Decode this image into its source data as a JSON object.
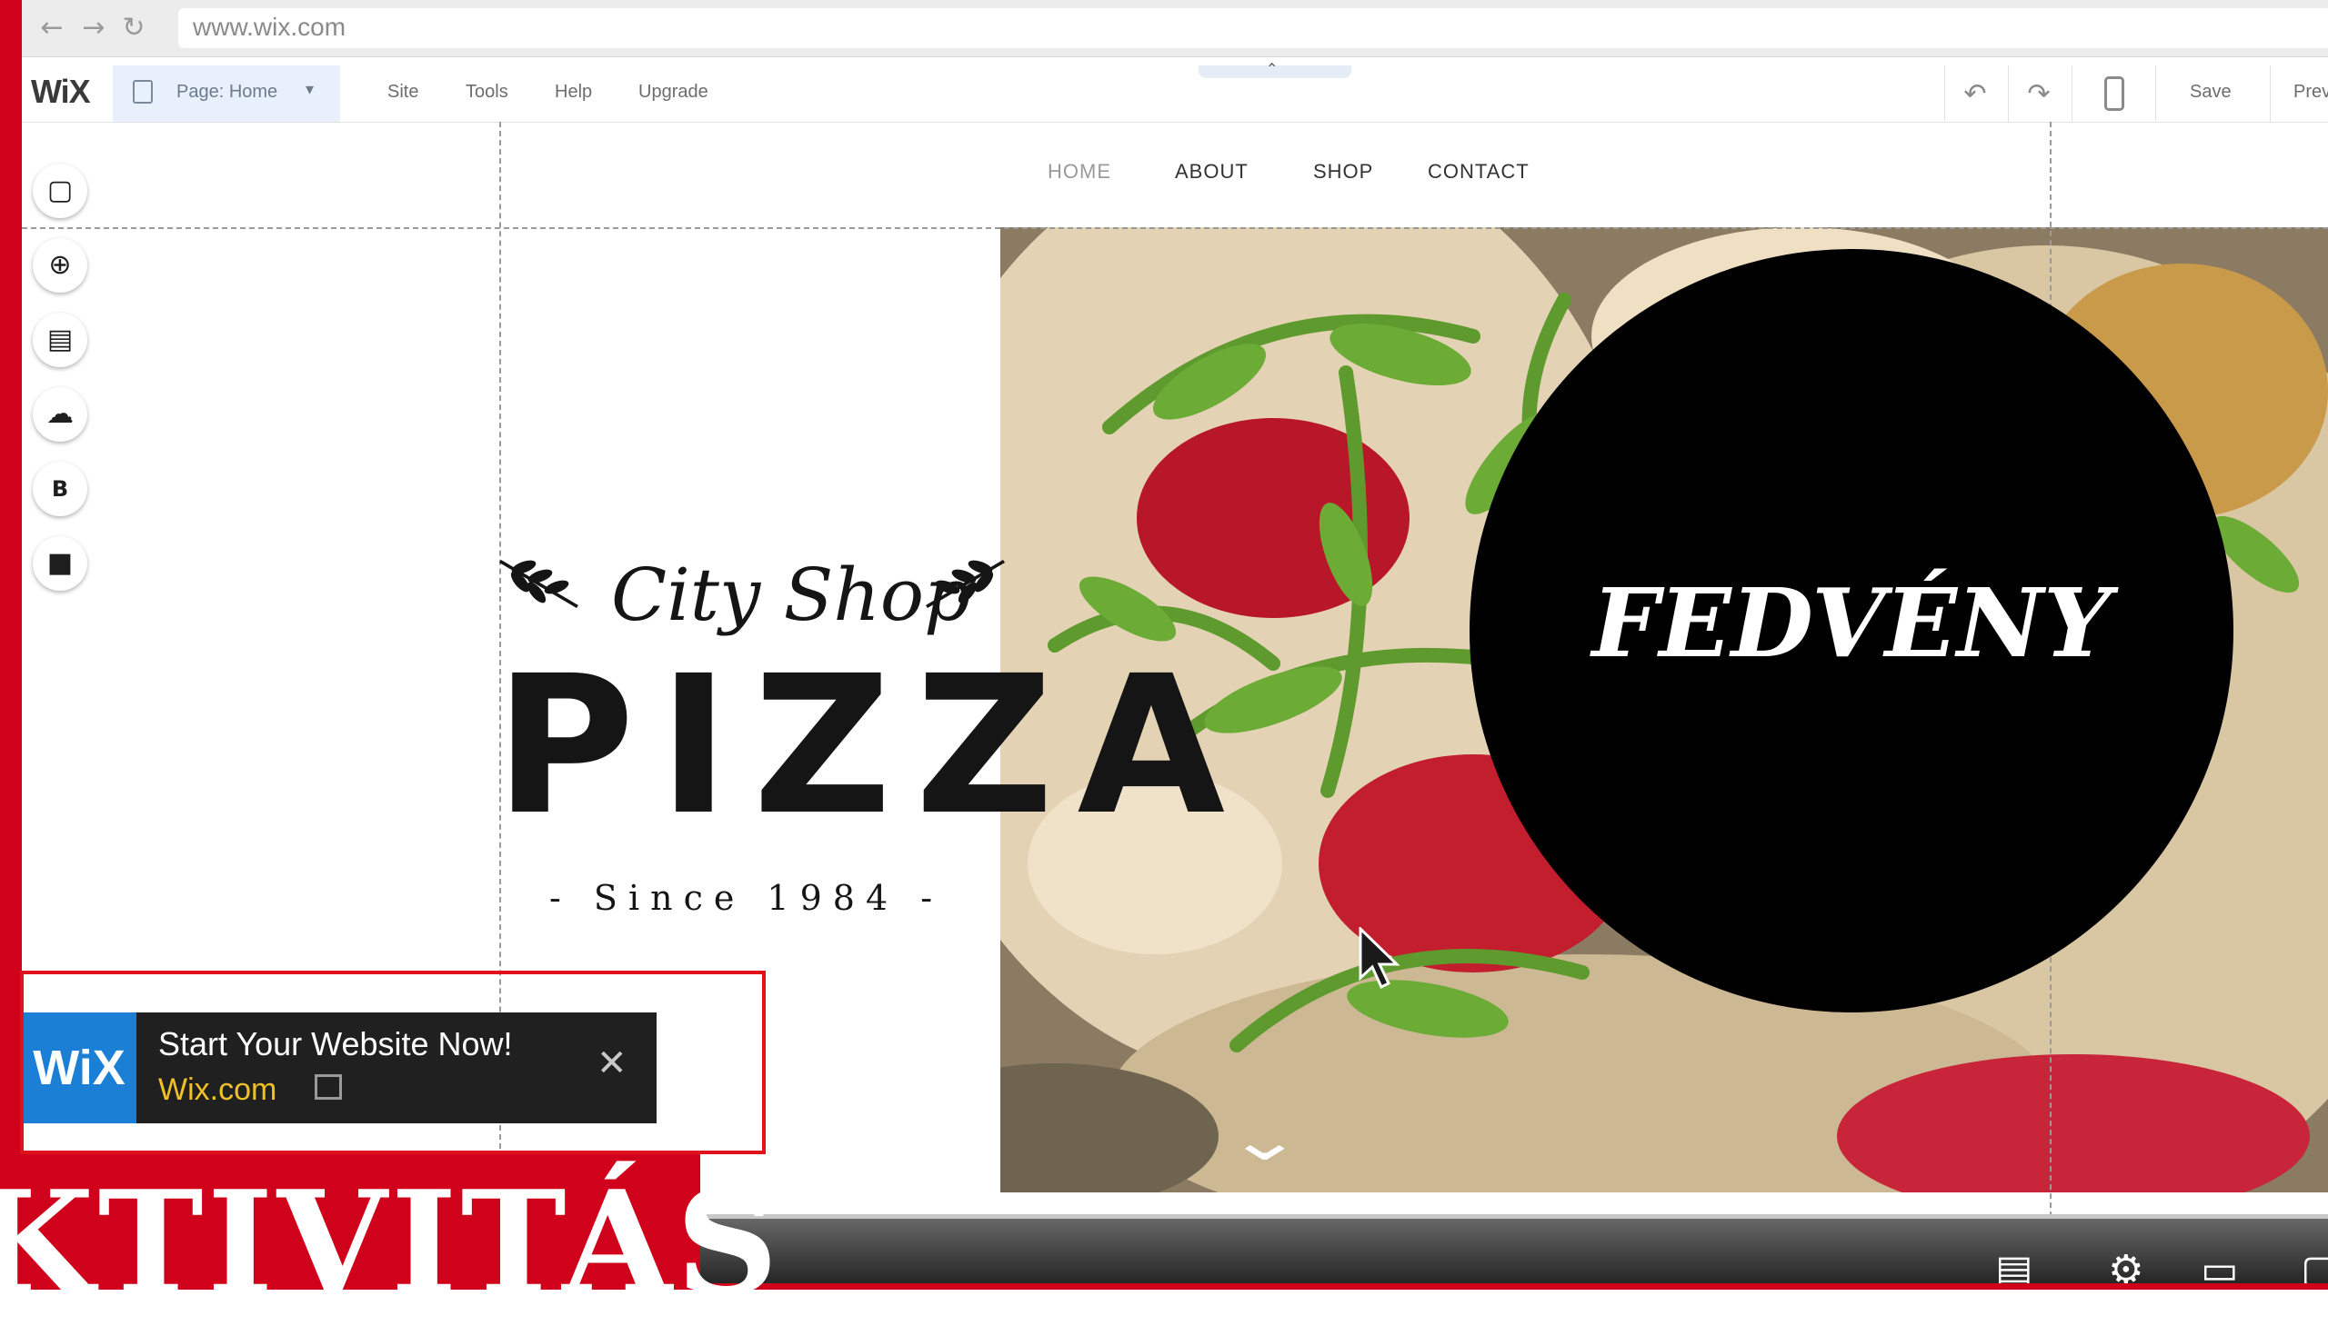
{
  "browser": {
    "url": "www.wix.com",
    "back_icon": "arrow-left-icon",
    "forward_icon": "arrow-right-icon",
    "reload_icon": "reload-icon"
  },
  "editor": {
    "logo": "WiX",
    "page_label": "Page: Home",
    "menu": [
      "Site",
      "Tools",
      "Help",
      "Upgrade"
    ],
    "save_label": "Save",
    "preview_label": "Prev"
  },
  "tools": [
    "background-icon",
    "add-icon",
    "app-market-icon",
    "upload-icon",
    "blog-icon",
    "store-icon"
  ],
  "site": {
    "nav": [
      "HOME",
      "ABOUT",
      "SHOP",
      "CONTACT"
    ],
    "logo_script": "City Shop",
    "logo_main": "PIZZA",
    "logo_since": "- Since 1984 -"
  },
  "overlay": {
    "circle_text": "FEDVÉNY",
    "banner_text": "KTIVITÁS"
  },
  "ad": {
    "logo": "WiX",
    "title": "Start Your Website Now!",
    "domain": "Wix.com"
  },
  "colors": {
    "accent_red": "#d0021b",
    "wix_blue": "#1b7fd6",
    "ad_domain_yellow": "#f0c028"
  }
}
